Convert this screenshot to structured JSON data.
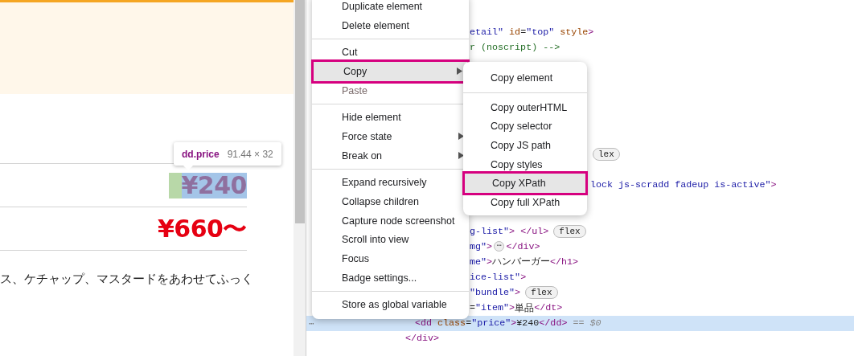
{
  "page": {
    "inspector_tooltip": {
      "selector": "dd.price",
      "size": "91.44 × 32"
    },
    "price_rows": [
      {
        "price": "¥240",
        "inspected": true
      },
      {
        "price": "¥660〜",
        "inspected": false
      }
    ],
    "description": "ス、ケチャップ、マスタードをあわせてふっく"
  },
  "elements_panel": {
    "lines": [
      {
        "selected": false,
        "tokens": [
          {
            "kind": "value",
            "text": "etail\""
          },
          {
            "kind": "attr",
            "text": " id"
          },
          {
            "kind": "text",
            "text": "="
          },
          {
            "kind": "value",
            "text": "\"top\""
          },
          {
            "kind": "attr",
            "text": " style"
          },
          {
            "kind": "tag",
            "text": ">"
          }
        ]
      },
      {
        "selected": false,
        "tokens": [
          {
            "kind": "comment",
            "text": "r (noscript) -->"
          }
        ]
      },
      {
        "selected": false,
        "tokens": [
          {
            "kind": "badge",
            "text": "lex"
          }
        ]
      },
      {
        "selected": false,
        "tokens": [
          {
            "kind": "value",
            "text": "lock js-scradd fadeup is-active\""
          },
          {
            "kind": "tag",
            "text": ">"
          }
        ]
      },
      {
        "selected": false,
        "tokens": [
          {
            "kind": "value",
            "text": "g-list\""
          },
          {
            "kind": "tag",
            "text": "> </ul>"
          },
          {
            "kind": "badge",
            "text": "flex"
          }
        ]
      },
      {
        "selected": false,
        "tokens": [
          {
            "kind": "value",
            "text": "mg\""
          },
          {
            "kind": "tag",
            "text": ">"
          },
          {
            "kind": "ellipsis",
            "text": "⋯"
          },
          {
            "kind": "tag",
            "text": "</div>"
          }
        ]
      },
      {
        "selected": false,
        "tokens": [
          {
            "kind": "value",
            "text": "me\""
          },
          {
            "kind": "tag",
            "text": ">"
          },
          {
            "kind": "text",
            "text": "ハンバーガー"
          },
          {
            "kind": "tag",
            "text": "</h1>"
          }
        ]
      },
      {
        "selected": false,
        "tokens": [
          {
            "kind": "value",
            "text": "ice-list\""
          },
          {
            "kind": "tag",
            "text": ">"
          }
        ]
      },
      {
        "selected": false,
        "tokens": [
          {
            "kind": "value",
            "text": "\"bundle\""
          },
          {
            "kind": "tag",
            "text": ">"
          },
          {
            "kind": "badge",
            "text": "flex"
          }
        ]
      },
      {
        "selected": false,
        "tokens": [
          {
            "kind": "text",
            "text": "="
          },
          {
            "kind": "value",
            "text": "\"item\""
          },
          {
            "kind": "tag",
            "text": ">"
          },
          {
            "kind": "text",
            "text": "単品"
          },
          {
            "kind": "tag",
            "text": "</dt>"
          }
        ]
      },
      {
        "selected": true,
        "gutter": "⋯",
        "tokens": [
          {
            "kind": "tag",
            "text": "<dd"
          },
          {
            "kind": "attr",
            "text": " class"
          },
          {
            "kind": "text",
            "text": "="
          },
          {
            "kind": "value",
            "text": "\"price\""
          },
          {
            "kind": "tag",
            "text": ">"
          },
          {
            "kind": "text",
            "text": "¥240"
          },
          {
            "kind": "tag",
            "text": "</dd>"
          },
          {
            "kind": "eval",
            "text": " == $0"
          }
        ]
      },
      {
        "selected": false,
        "tokens": [
          {
            "kind": "tag",
            "text": "</div>"
          }
        ]
      }
    ]
  },
  "context_menu": {
    "items": [
      {
        "kind": "item",
        "label": "Duplicate element",
        "submenu": false,
        "selected": false,
        "disabled": false,
        "annotated": false
      },
      {
        "kind": "item",
        "label": "Delete element",
        "submenu": false,
        "selected": false,
        "disabled": false,
        "annotated": false
      },
      {
        "kind": "separator"
      },
      {
        "kind": "item",
        "label": "Cut",
        "submenu": false,
        "selected": false,
        "disabled": false,
        "annotated": false
      },
      {
        "kind": "item",
        "label": "Copy",
        "submenu": true,
        "selected": true,
        "disabled": false,
        "annotated": true
      },
      {
        "kind": "item",
        "label": "Paste",
        "submenu": false,
        "selected": false,
        "disabled": true,
        "annotated": false
      },
      {
        "kind": "separator"
      },
      {
        "kind": "item",
        "label": "Hide element",
        "submenu": false,
        "selected": false,
        "disabled": false,
        "annotated": false
      },
      {
        "kind": "item",
        "label": "Force state",
        "submenu": true,
        "selected": false,
        "disabled": false,
        "annotated": false
      },
      {
        "kind": "item",
        "label": "Break on",
        "submenu": true,
        "selected": false,
        "disabled": false,
        "annotated": false
      },
      {
        "kind": "separator"
      },
      {
        "kind": "item",
        "label": "Expand recursively",
        "submenu": false,
        "selected": false,
        "disabled": false,
        "annotated": false
      },
      {
        "kind": "item",
        "label": "Collapse children",
        "submenu": false,
        "selected": false,
        "disabled": false,
        "annotated": false
      },
      {
        "kind": "item",
        "label": "Capture node screenshot",
        "submenu": false,
        "selected": false,
        "disabled": false,
        "annotated": false
      },
      {
        "kind": "item",
        "label": "Scroll into view",
        "submenu": false,
        "selected": false,
        "disabled": false,
        "annotated": false
      },
      {
        "kind": "item",
        "label": "Focus",
        "submenu": false,
        "selected": false,
        "disabled": false,
        "annotated": false
      },
      {
        "kind": "item",
        "label": "Badge settings...",
        "submenu": false,
        "selected": false,
        "disabled": false,
        "annotated": false
      },
      {
        "kind": "separator"
      },
      {
        "kind": "item",
        "label": "Store as global variable",
        "submenu": false,
        "selected": false,
        "disabled": false,
        "annotated": false
      }
    ]
  },
  "copy_submenu": {
    "items": [
      {
        "kind": "item",
        "label": "Copy element",
        "selected": false,
        "annotated": false
      },
      {
        "kind": "separator"
      },
      {
        "kind": "item",
        "label": "Copy outerHTML",
        "selected": false,
        "annotated": false
      },
      {
        "kind": "item",
        "label": "Copy selector",
        "selected": false,
        "annotated": false
      },
      {
        "kind": "item",
        "label": "Copy JS path",
        "selected": false,
        "annotated": false
      },
      {
        "kind": "item",
        "label": "Copy styles",
        "selected": false,
        "annotated": false
      },
      {
        "kind": "item",
        "label": "Copy XPath",
        "selected": true,
        "annotated": true
      },
      {
        "kind": "item",
        "label": "Copy full XPath",
        "selected": false,
        "annotated": false
      }
    ]
  }
}
